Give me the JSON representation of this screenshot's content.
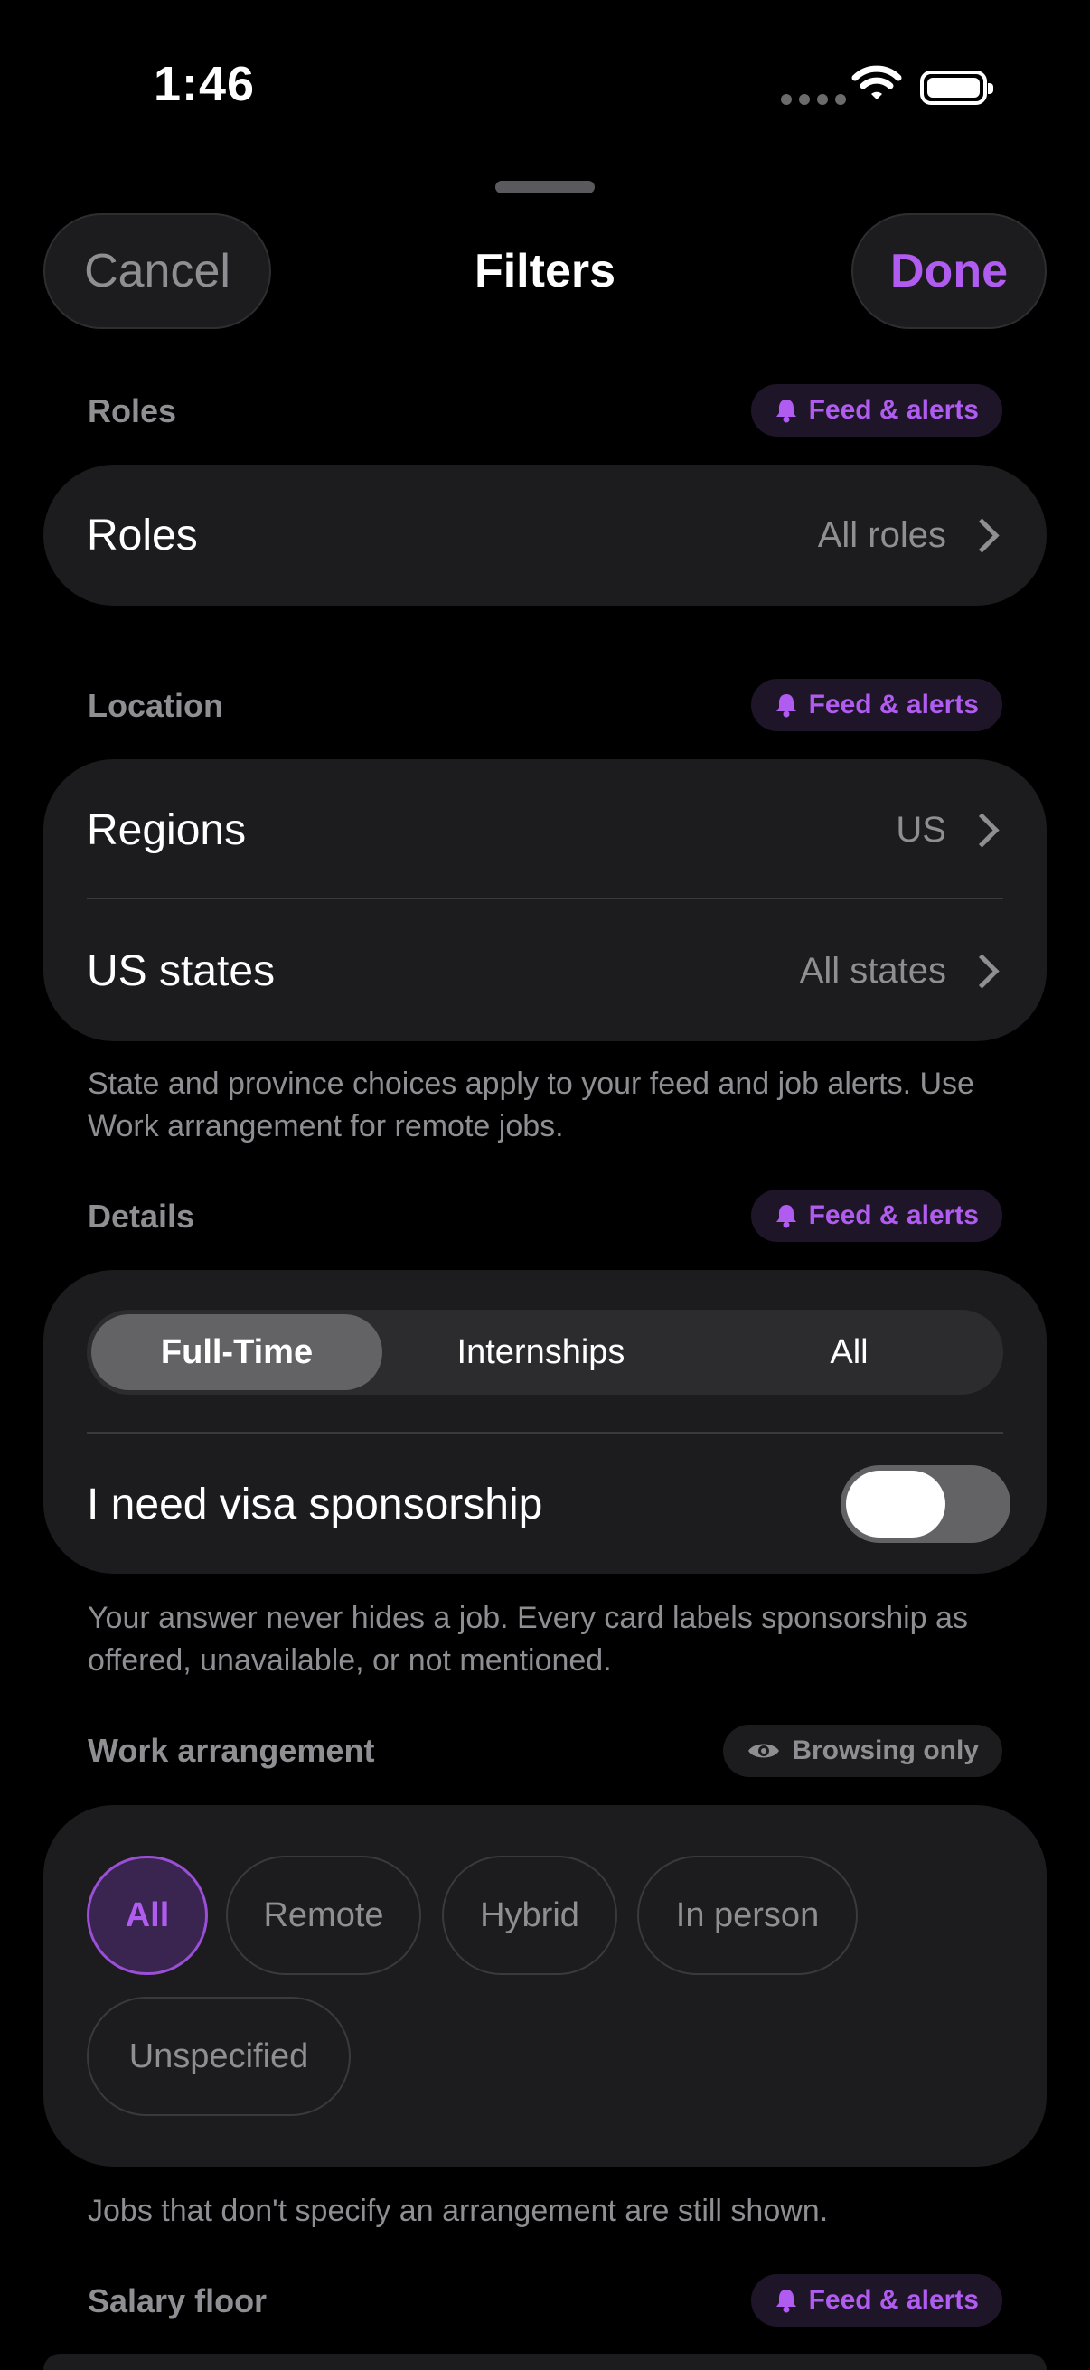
{
  "status_bar": {
    "time": "1:46"
  },
  "header": {
    "cancel_label": "Cancel",
    "title": "Filters",
    "done_label": "Done"
  },
  "badges": {
    "feed_alerts": "Feed & alerts",
    "browsing_only": "Browsing only"
  },
  "roles_section": {
    "label": "Roles",
    "rows": [
      {
        "label": "Roles",
        "value": "All roles"
      }
    ]
  },
  "location_section": {
    "label": "Location",
    "rows": [
      {
        "label": "Regions",
        "value": "US"
      },
      {
        "label": "US states",
        "value": "All states"
      }
    ],
    "footnote": "State and province choices apply to your feed and job alerts. Use Work arrangement for remote jobs."
  },
  "details_section": {
    "label": "Details",
    "segments": [
      "Full-Time",
      "Internships",
      "All"
    ],
    "selected_segment": "Full-Time",
    "visa_label": "I need visa sponsorship",
    "visa_toggle_on": false,
    "footnote": "Your answer never hides a job. Every card labels sponsorship as offered, unavailable, or not mentioned."
  },
  "work_section": {
    "label": "Work arrangement",
    "chips": [
      "All",
      "Remote",
      "Hybrid",
      "In person",
      "Unspecified"
    ],
    "selected_chip": "All",
    "footnote": "Jobs that don't specify an arrangement are still shown."
  },
  "salary_section": {
    "label": "Salary floor"
  },
  "colors": {
    "accent": "#b15cf0",
    "background": "#000000",
    "card": "#1c1c1e",
    "secondary_text": "#8e8e93"
  }
}
